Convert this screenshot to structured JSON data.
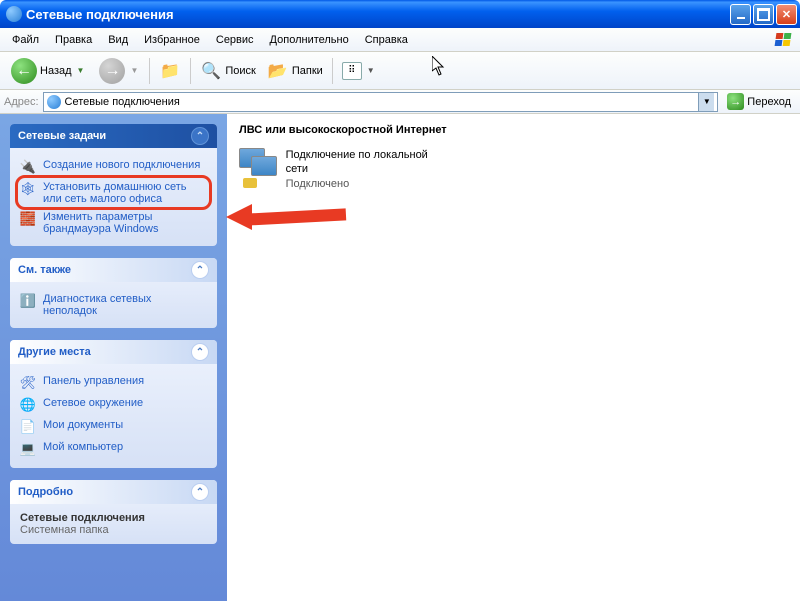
{
  "window": {
    "title": "Сетевые подключения"
  },
  "menu": {
    "items": [
      "Файл",
      "Правка",
      "Вид",
      "Избранное",
      "Сервис",
      "Дополнительно",
      "Справка"
    ]
  },
  "toolbar": {
    "back": "Назад",
    "search": "Поиск",
    "folders": "Папки"
  },
  "address": {
    "label": "Адрес:",
    "value": "Сетевые подключения",
    "go": "Переход"
  },
  "panels": {
    "tasks": {
      "title": "Сетевые задачи",
      "items": [
        {
          "label": "Создание нового подключения"
        },
        {
          "label": "Установить домашнюю сеть или сеть малого офиса"
        },
        {
          "label": "Изменить параметры брандмауэра Windows"
        }
      ]
    },
    "see_also": {
      "title": "См. также",
      "items": [
        {
          "label": "Диагностика сетевых неполадок"
        }
      ]
    },
    "other_places": {
      "title": "Другие места",
      "items": [
        {
          "label": "Панель управления"
        },
        {
          "label": "Сетевое окружение"
        },
        {
          "label": "Мои документы"
        },
        {
          "label": "Мой компьютер"
        }
      ]
    },
    "details": {
      "title": "Подробно",
      "name": "Сетевые подключения",
      "type": "Системная папка"
    }
  },
  "main": {
    "category": "ЛВС или высокоскоростной Интернет",
    "connection": {
      "name": "Подключение по локальной сети",
      "status": "Подключено"
    }
  }
}
